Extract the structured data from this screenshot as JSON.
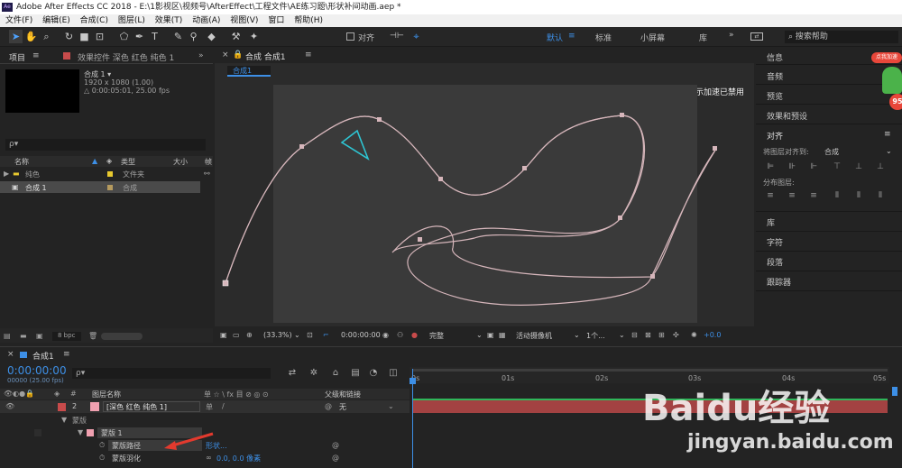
{
  "window": {
    "title": "Adobe After Effects CC 2018 - E:\\1影视区\\视频号\\AfterEffect\\工程文件\\AE练习题\\形状补间动画.aep *",
    "logo": "Ae"
  },
  "menu": [
    "文件(F)",
    "编辑(E)",
    "合成(C)",
    "图层(L)",
    "效果(T)",
    "动画(A)",
    "视图(V)",
    "窗口",
    "帮助(H)"
  ],
  "toolbar": {
    "snap_label": "对齐",
    "workspaces": [
      "默认",
      "标准",
      "小屏幕",
      "库"
    ],
    "search_placeholder": "搜索帮助"
  },
  "project": {
    "tab_label": "项目",
    "effects_tab": "效果控件 深色 红色 纯色 1",
    "selected_name": "合成 1 ▾",
    "selected_size": "1920 x 1080 (1.00)",
    "selected_duration": "△ 0:00:05:01, 25.00 fps",
    "search_placeholder": "ρ▾",
    "columns": [
      "名称",
      "类型",
      "大小",
      "帧"
    ],
    "items": [
      {
        "name": "纯色",
        "type": "文件夹",
        "color": "#e8c92f"
      },
      {
        "name": "合成 1",
        "type": "合成",
        "color": "#b59a5e"
      }
    ],
    "bpc": "8 bpc"
  },
  "comp": {
    "tab_label": "合成 合成1",
    "sub_tab": "合成1",
    "gpu_notice": "显示加速已禁用",
    "zoom": "(33.3%)",
    "timecode": "0:00:00:00",
    "quality": "完整",
    "camera": "活动摄像机",
    "views": "1个...",
    "offset": "+0.0"
  },
  "right_panel": {
    "items_top": [
      "信息",
      "音频",
      "预览",
      "效果和预设"
    ],
    "align_header": "对齐",
    "align_to_label": "将图层对齐到:",
    "align_to_value": "合成",
    "distribute_label": "分布图层:",
    "items_bottom": [
      "库",
      "字符",
      "段落",
      "跟踪器"
    ]
  },
  "timeline": {
    "tab_label": "合成1",
    "timecode": "0:00:00:00",
    "frame_info": "00000 (25.00 fps)",
    "search_placeholder": "ρ▾",
    "layer_name_header": "图层名称",
    "switches_header": "单 ☆ \\ fx 目 ⊘ ◎ ⊙",
    "parent_header": "父级和链接",
    "ruler": [
      "0s",
      "01s",
      "02s",
      "03s",
      "04s",
      "05s"
    ],
    "layer": {
      "num": "2",
      "name": "[深色 红色 纯色 1]",
      "parent": "无",
      "color": "#c84b4b"
    },
    "sub_rows": [
      {
        "label": "蒙版",
        "indent": 1
      },
      {
        "label": "蒙版 1",
        "indent": 2
      },
      {
        "label": "蒙版路径",
        "value": "形状...",
        "indent": 3
      },
      {
        "label": "蒙版羽化",
        "value": "0.0, 0.0 像素",
        "indent": 3
      }
    ]
  },
  "watermark": {
    "brand": "Baidu经验",
    "url": "jingyan.baidu.com"
  },
  "ad_badge": {
    "label": "点我加速",
    "value": "95"
  }
}
